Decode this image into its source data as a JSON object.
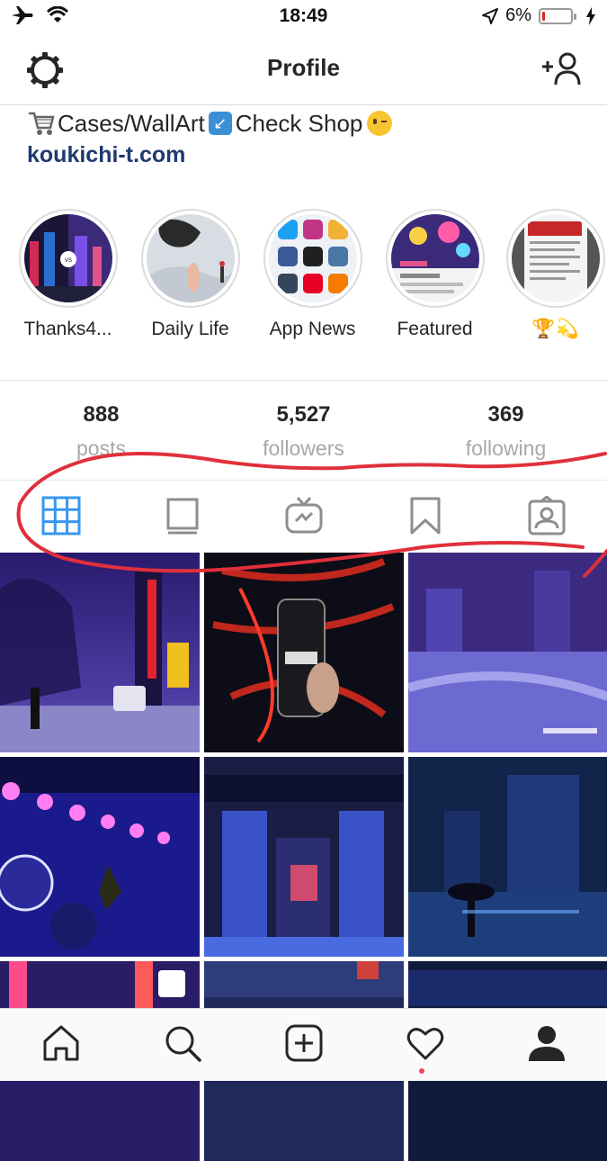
{
  "status_bar": {
    "time": "18:49",
    "battery_text": "6%",
    "battery_level": 0.06,
    "icons": [
      "airplane-icon",
      "wifi-icon",
      "location-arrow-icon",
      "battery-icon",
      "charging-bolt-icon"
    ]
  },
  "header": {
    "title": "Profile",
    "left_icon": "settings-gear-icon",
    "right_icon": "add-user-icon"
  },
  "bio": {
    "line_text_1": "Cases/WallArt",
    "line_text_2": "Check Shop",
    "emojis": [
      "shopping-cart-emoji",
      "arrow-down-left-emoji",
      "winking-face-emoji"
    ],
    "link": "koukichi-t.com"
  },
  "highlights": [
    {
      "label": "Thanks4..."
    },
    {
      "label": "Daily Life"
    },
    {
      "label": "App News"
    },
    {
      "label": "Featured"
    },
    {
      "label": "🏆💫"
    }
  ],
  "stats": [
    {
      "value": "888",
      "label": "posts"
    },
    {
      "value": "5,527",
      "label": "followers"
    },
    {
      "value": "369",
      "label": "following"
    }
  ],
  "tabs": [
    {
      "icon": "grid-icon",
      "active": true
    },
    {
      "icon": "feed-list-icon",
      "active": false
    },
    {
      "icon": "igtv-icon",
      "active": false
    },
    {
      "icon": "bookmark-icon",
      "active": false
    },
    {
      "icon": "tagged-user-icon",
      "active": false
    }
  ],
  "bottom_nav": [
    {
      "icon": "home-icon"
    },
    {
      "icon": "search-icon"
    },
    {
      "icon": "new-post-icon"
    },
    {
      "icon": "activity-heart-icon",
      "has_notification": true
    },
    {
      "icon": "profile-icon"
    }
  ],
  "colors": {
    "accent_blue": "#3897f0",
    "link_blue": "#1f3a6e",
    "annotation_red": "#e0303b",
    "notification_dot": "#ed4956"
  }
}
